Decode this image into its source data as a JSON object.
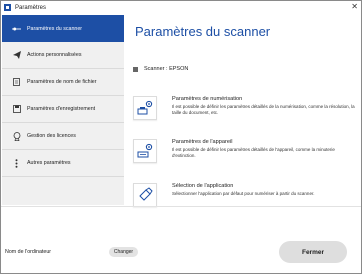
{
  "window": {
    "title": "Paramètres",
    "close_glyph": "✕"
  },
  "sidebar": {
    "items": [
      {
        "label": "Paramètres du scanner",
        "icon": "scanner-settings-icon"
      },
      {
        "label": "Actions personnalisées",
        "icon": "send-icon"
      },
      {
        "label": "Paramètres de nom de fichier",
        "icon": "file-icon"
      },
      {
        "label": "Paramètres d'enregistrement",
        "icon": "save-folder-icon"
      },
      {
        "label": "Gestion des licences",
        "icon": "license-icon"
      },
      {
        "label": "Autres paramètres",
        "icon": "more-icon"
      }
    ]
  },
  "main": {
    "title": "Paramètres du scanner",
    "scanner_line": "Scanner :  EPSON",
    "options": [
      {
        "title": "Paramètres de numérisation",
        "desc": "Il est possible de définir les paramètres détaillés de la numérisation, comme la résolution, la taille du document, etc.",
        "icon": "scan-settings-icon"
      },
      {
        "title": "Paramètres de l'appareil",
        "desc": "Il est possible de définir les paramètres détaillés de l'appareil, comme la minuterie d'extinction.",
        "icon": "device-settings-icon"
      },
      {
        "title": "Sélection de l'application",
        "desc": "Sélectionner l'application par défaut pour numériser à partir du scanner.",
        "icon": "app-select-icon"
      }
    ]
  },
  "footer": {
    "computer_name_label": "Nom de l'ordinateur",
    "change_label": "Changer",
    "close_label": "Fermer"
  },
  "colors": {
    "accent": "#1d4fa5",
    "sidebar_bg": "#f0f0f0"
  }
}
